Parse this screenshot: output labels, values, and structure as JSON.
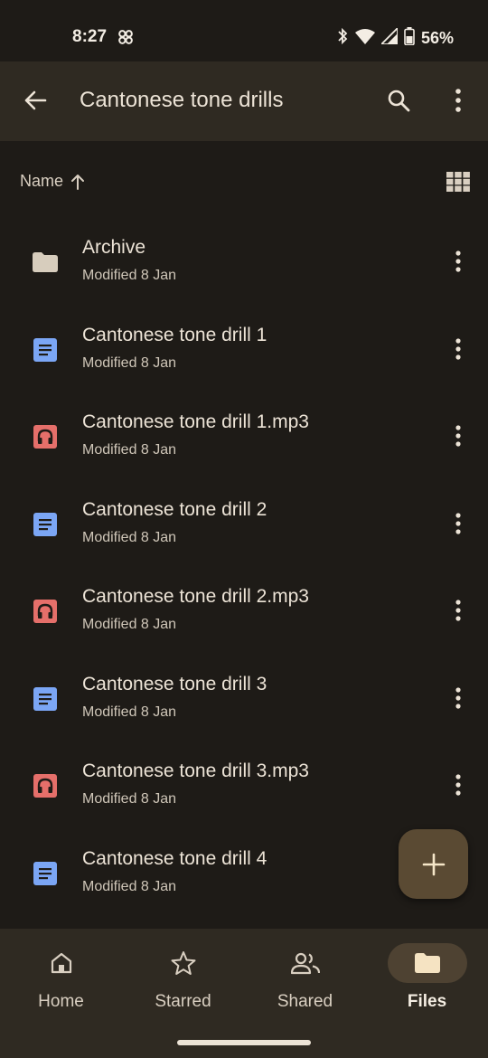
{
  "status_bar": {
    "time": "8:27",
    "battery": "56%"
  },
  "app_bar": {
    "title": "Cantonese tone drills"
  },
  "sort": {
    "label": "Name"
  },
  "files": [
    {
      "name": "Archive",
      "meta": "Modified 8 Jan",
      "icon": "folder-icon",
      "color": "#d7cdbd"
    },
    {
      "name": "Cantonese tone drill 1",
      "meta": "Modified 8 Jan",
      "icon": "document-icon",
      "color": "#7ba6f5"
    },
    {
      "name": "Cantonese tone drill 1.mp3",
      "meta": "Modified 8 Jan",
      "icon": "audio-icon",
      "color": "#e56f6a"
    },
    {
      "name": "Cantonese tone drill 2",
      "meta": "Modified 8 Jan",
      "icon": "document-icon",
      "color": "#7ba6f5"
    },
    {
      "name": "Cantonese tone drill 2.mp3",
      "meta": "Modified 8 Jan",
      "icon": "audio-icon",
      "color": "#e56f6a"
    },
    {
      "name": "Cantonese tone drill 3",
      "meta": "Modified 8 Jan",
      "icon": "document-icon",
      "color": "#7ba6f5"
    },
    {
      "name": "Cantonese tone drill 3.mp3",
      "meta": "Modified 8 Jan",
      "icon": "audio-icon",
      "color": "#e56f6a"
    },
    {
      "name": "Cantonese tone drill 4",
      "meta": "Modified 8 Jan",
      "icon": "document-icon",
      "color": "#7ba6f5"
    }
  ],
  "bottom_nav": {
    "items": [
      {
        "label": "Home",
        "icon": "home-icon",
        "active": false
      },
      {
        "label": "Starred",
        "icon": "star-icon",
        "active": false
      },
      {
        "label": "Shared",
        "icon": "people-icon",
        "active": false
      },
      {
        "label": "Files",
        "icon": "folder-icon",
        "active": true
      }
    ]
  },
  "colors": {
    "background": "#1e1b17",
    "app_bar": "#2f2a22",
    "fab": "#5a4a33",
    "document": "#7ba6f5",
    "audio": "#e56f6a"
  }
}
